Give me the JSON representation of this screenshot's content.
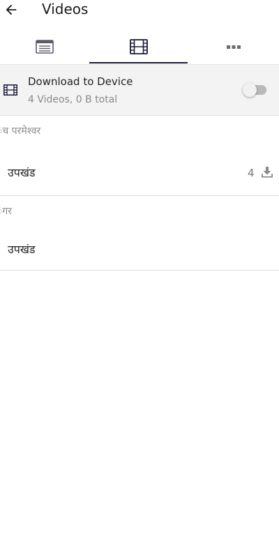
{
  "header": {
    "title": "Videos",
    "back_icon": "arrow-left-icon"
  },
  "tabs": [
    {
      "icon": "list-icon",
      "selected": false
    },
    {
      "icon": "film-icon",
      "selected": true
    },
    {
      "icon": "more-horizontal-icon",
      "selected": false
    }
  ],
  "download": {
    "icon": "film-icon",
    "title": "Download to Device",
    "subtitle": "4 Videos, 0 B total",
    "toggle_on": false
  },
  "sections": [
    {
      "header": "ंच परमेश्वर",
      "items": [
        {
          "label": "उपखंड",
          "count": "4",
          "icon": "download-icon"
        }
      ]
    },
    {
      "header": "ंगर",
      "items": [
        {
          "label": "उपखंड"
        }
      ]
    }
  ],
  "colors": {
    "accent": "#1a1838",
    "muted_text": "#8a8a8a",
    "row_bg": "#f3f3f3"
  }
}
